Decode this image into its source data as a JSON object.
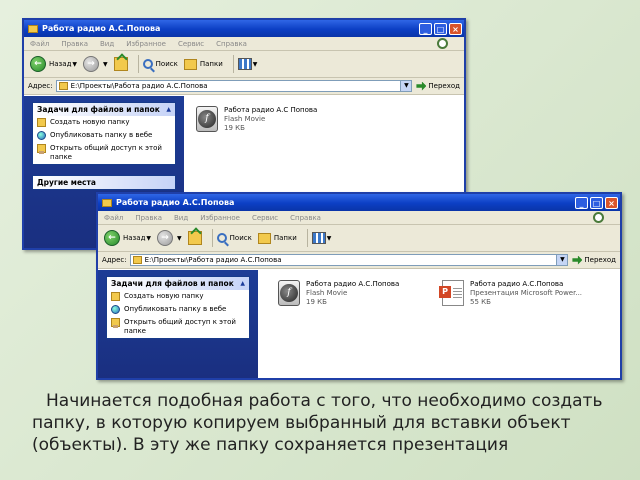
{
  "colors": {
    "titlebar": "#0c3fc4",
    "taskpane": "#1d3c96",
    "slide_bg": "#d7e6cc"
  },
  "window1": {
    "title": "Работа радио А.С.Попова",
    "menu": [
      "Файл",
      "Правка",
      "Вид",
      "Избранное",
      "Сервис",
      "Справка"
    ],
    "toolbar": {
      "back": "Назад",
      "search": "Поиск",
      "folders": "Папки"
    },
    "address": {
      "label": "Адрес:",
      "value": "E:\\Проекты\\Работа радио А.С.Попова",
      "go": "Переход"
    },
    "tasks": {
      "header": "Задачи для файлов и папок",
      "items": [
        "Создать новую папку",
        "Опубликовать папку в вебе",
        "Открыть общий доступ к этой папке"
      ]
    },
    "other_header": "Другие места",
    "files": [
      {
        "name": "Работа радио А.С Попова",
        "type": "Flash Movie",
        "size": "19 КБ"
      }
    ]
  },
  "window2": {
    "title": "Работа радио А.С.Попова",
    "menu": [
      "Файл",
      "Правка",
      "Вид",
      "Избранное",
      "Сервис",
      "Справка"
    ],
    "toolbar": {
      "back": "Назад",
      "search": "Поиск",
      "folders": "Папки"
    },
    "address": {
      "label": "Адрес:",
      "value": "E:\\Проекты\\Работа радио А.С.Попова",
      "go": "Переход"
    },
    "tasks": {
      "header": "Задачи для файлов и папок",
      "items": [
        "Создать новую папку",
        "Опубликовать папку в вебе",
        "Открыть общий доступ к этой папке"
      ]
    },
    "files": [
      {
        "name": "Работа радио А.С.Попова",
        "type": "Flash Movie",
        "size": "19 КБ"
      },
      {
        "name": "Работа радио А.С.Попова",
        "type": "Презентация Microsoft Power...",
        "size": "55 КБ"
      }
    ]
  },
  "caption": "Начинается подобная работа с того, что необходимо создать папку, в которую копируем выбранный для вставки объект (объекты). В эту же папку сохраняется презентация"
}
